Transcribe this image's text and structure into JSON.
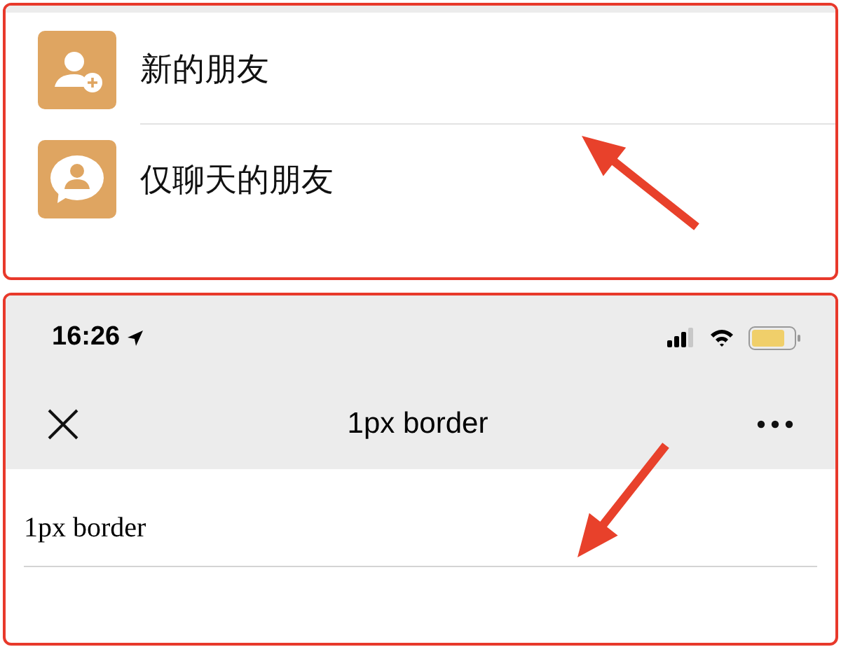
{
  "contacts_panel": {
    "items": [
      {
        "label": "新的朋友",
        "kind": "new_friend"
      },
      {
        "label": "仅聊天的朋友",
        "kind": "chat_only"
      }
    ]
  },
  "phone_panel": {
    "status_bar": {
      "time": "16:26"
    },
    "nav_bar": {
      "title": "1px border"
    },
    "content": {
      "text": "1px border"
    }
  }
}
